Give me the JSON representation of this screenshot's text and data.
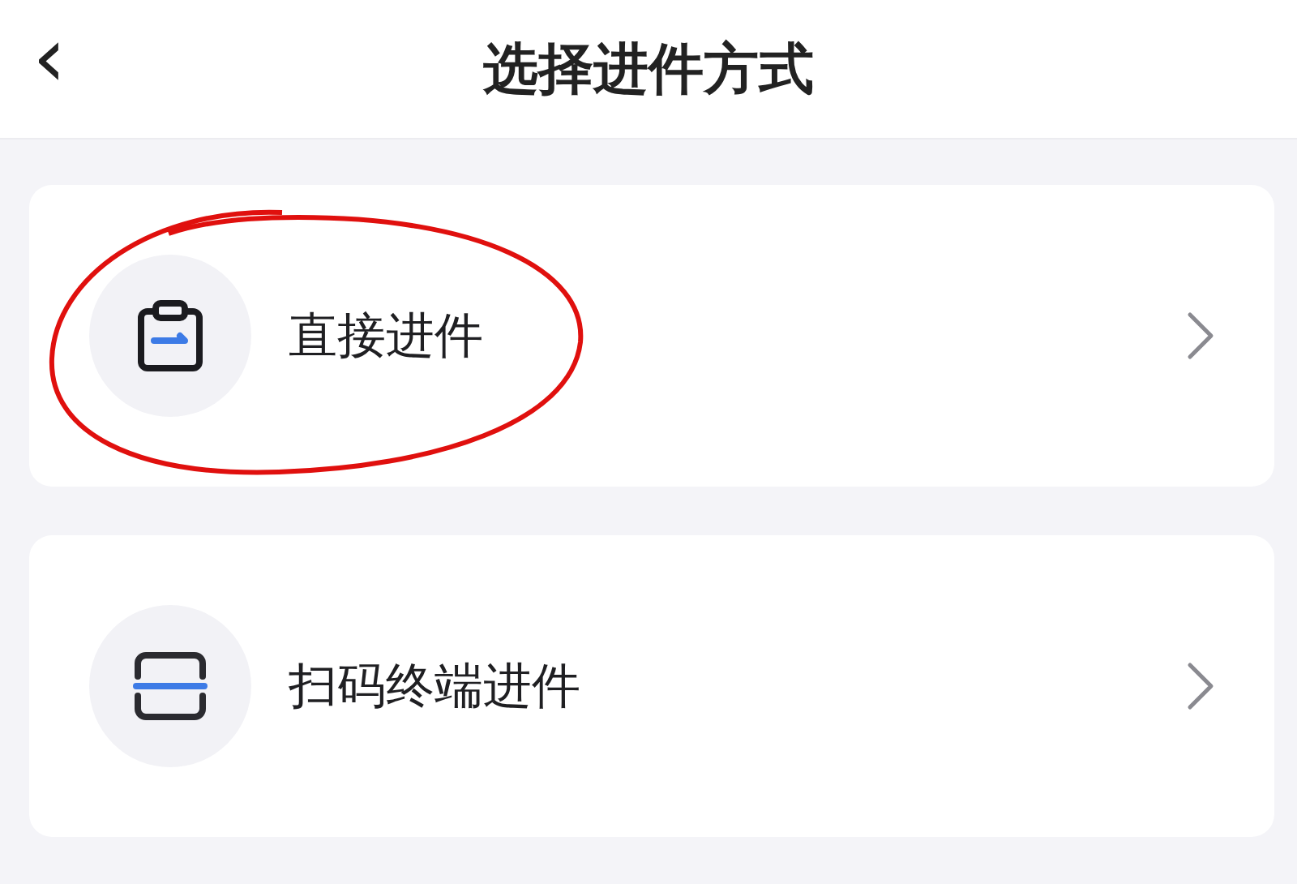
{
  "header": {
    "back_icon": "‹",
    "title": "选择进件方式"
  },
  "options": [
    {
      "kind": "clipboard",
      "label": "直接进件",
      "circled": true
    },
    {
      "kind": "scan",
      "label": "扫码终端进件",
      "circled": false
    }
  ]
}
